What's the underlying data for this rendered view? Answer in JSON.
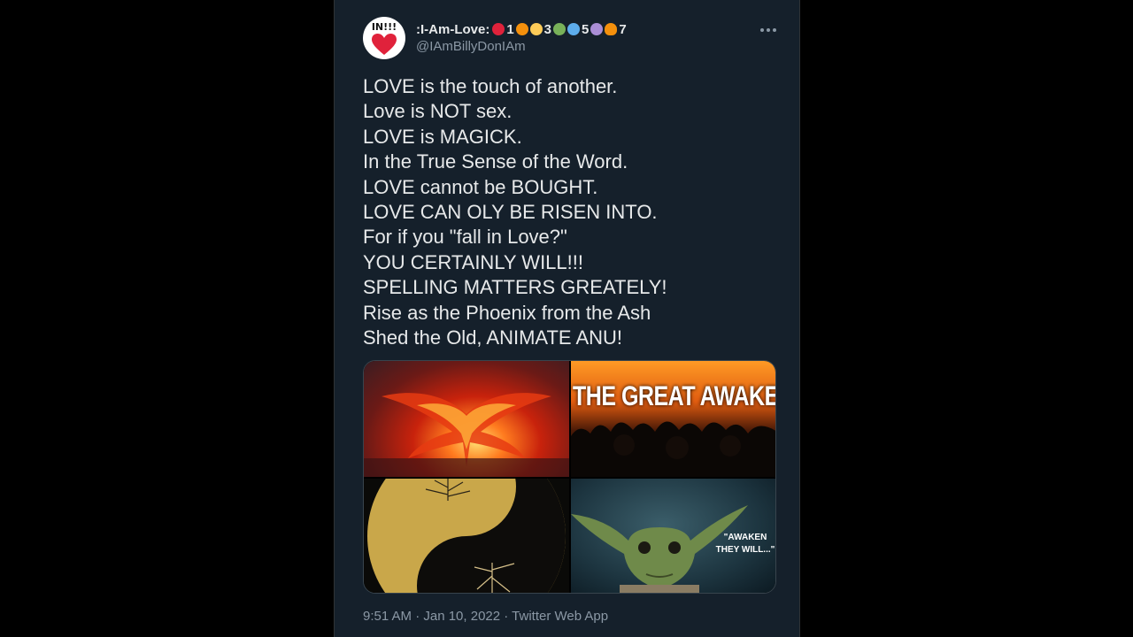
{
  "tweet": {
    "author": {
      "display_name": ":I-Am-Love:",
      "badge_numbers": [
        "1",
        "3",
        "5",
        "7"
      ],
      "handle": "@IAmBillyDonIAm",
      "avatar_text": "IN!!!"
    },
    "body_lines": [
      "LOVE is the touch of another.",
      "Love is NOT sex.",
      "LOVE is MAGICK.",
      "In the True Sense of the Word.",
      "LOVE cannot be BOUGHT.",
      "LOVE CAN OLY BE RISEN INTO.",
      "For if you \"fall in Love?\"",
      "YOU CERTAINLY WILL!!!",
      "SPELLING MATTERS GREATELY!",
      "Rise as the Phoenix from the Ash",
      "Shed the Old, ANIMATE ANU!"
    ],
    "media": {
      "awakening_text": "THE GREAT AWAKENING",
      "yoda_quote": "\"AWAKEN THEY WILL...\""
    },
    "meta_line": "9:51 AM · Jan 10, 2022 · Twitter Web App"
  },
  "colors": {
    "background": "#000000",
    "panel": "#15202b",
    "text": "#e7e9ea",
    "secondary": "#8b98a5"
  },
  "icons": [
    "heart-icon",
    "more-icon"
  ]
}
